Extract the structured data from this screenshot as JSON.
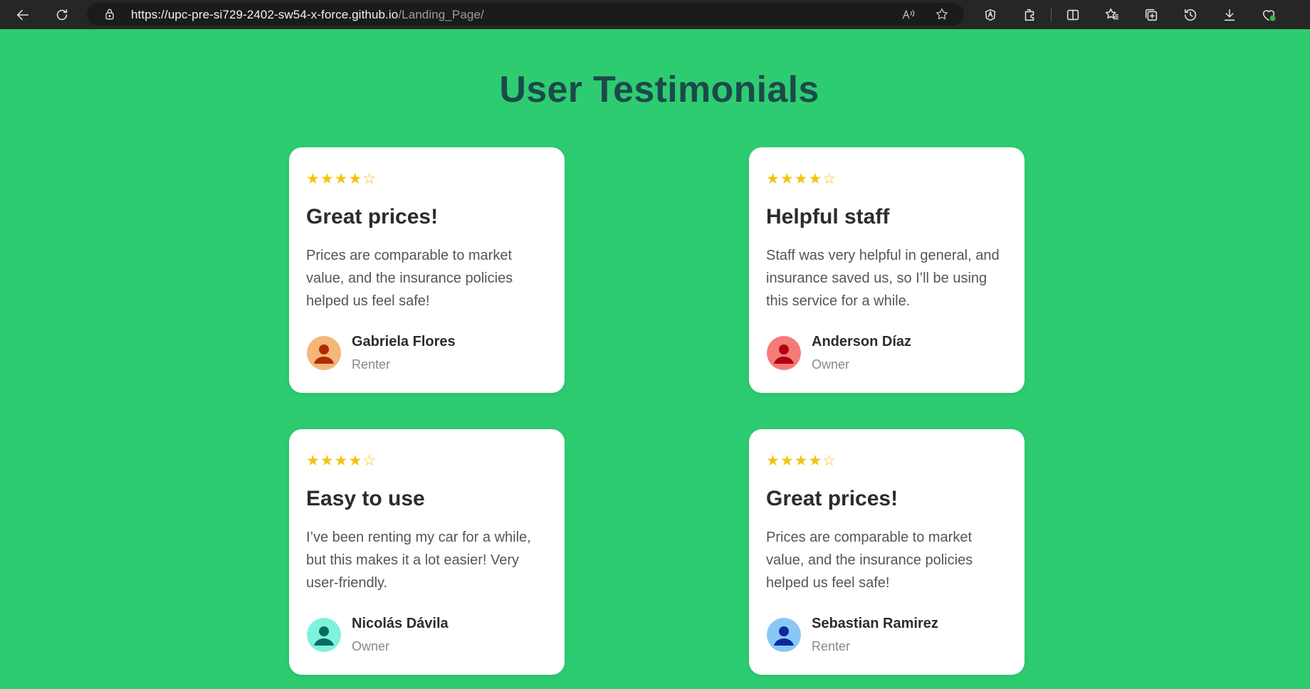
{
  "browser": {
    "url_main": "https://upc-pre-si729-2402-sw54-x-force.github.io",
    "url_path": "/Landing_Page/"
  },
  "section": {
    "title": "User Testimonials"
  },
  "testimonials": [
    {
      "stars": "★★★★☆",
      "rating": 4,
      "title": "Great prices!",
      "text": "Prices are comparable to market value, and the insurance policies helped us feel safe!",
      "name": "Gabriela Flores",
      "role": "Renter",
      "avatar_bg": "#f5b679",
      "avatar_fg": "#b02a00"
    },
    {
      "stars": "★★★★☆",
      "rating": 4,
      "title": "Helpful staff",
      "text": "Staff was very helpful in general, and insurance saved us, so I’ll be using this service for a while.",
      "name": "Anderson Díaz",
      "role": "Owner",
      "avatar_bg": "#f57b78",
      "avatar_fg": "#b00014"
    },
    {
      "stars": "★★★★☆",
      "rating": 4,
      "title": "Easy to use",
      "text": "I’ve been renting my car for a while, but this makes it a lot easier! Very user-friendly.",
      "name": "Nicolás Dávila",
      "role": "Owner",
      "avatar_bg": "#7ff2dd",
      "avatar_fg": "#0a6b62"
    },
    {
      "stars": "★★★★☆",
      "rating": 4,
      "title": "Great prices!",
      "text": "Prices are comparable to market value, and the insurance policies helped us feel safe!",
      "name": "Sebastian Ramirez",
      "role": "Renter",
      "avatar_bg": "#89c8f5",
      "avatar_fg": "#0b2a9b"
    }
  ],
  "colors": {
    "page_bg": "#2ecc71",
    "title": "#1b4a4a",
    "star": "#f1c40f"
  }
}
